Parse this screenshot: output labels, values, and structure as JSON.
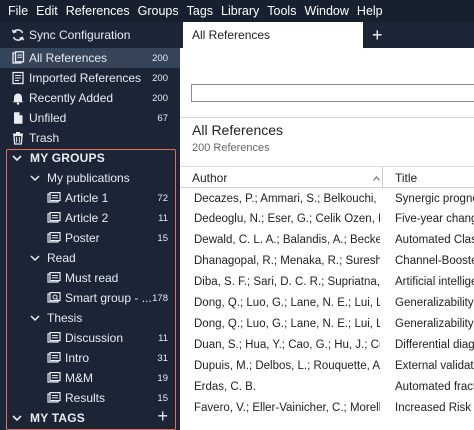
{
  "menubar": {
    "items": [
      "File",
      "Edit",
      "References",
      "Groups",
      "Tags",
      "Library",
      "Tools",
      "Window",
      "Help"
    ]
  },
  "sidebar": {
    "sync": {
      "label": "Sync Configuration",
      "icon": "sync-icon"
    },
    "library": [
      {
        "label": "All References",
        "count": "200",
        "icon": "references-icon",
        "selected": true
      },
      {
        "label": "Imported References",
        "count": "200",
        "icon": "imported-icon"
      },
      {
        "label": "Recently Added",
        "count": "200",
        "icon": "bell-icon"
      },
      {
        "label": "Unfiled",
        "count": "67",
        "icon": "document-icon"
      },
      {
        "label": "Trash",
        "count": "",
        "icon": "trash-icon"
      }
    ],
    "my_groups": {
      "label": "MY GROUPS",
      "folders": [
        {
          "label": "My publications",
          "children": [
            {
              "label": "Article 1",
              "count": "72"
            },
            {
              "label": "Article 2",
              "count": "11"
            },
            {
              "label": "Poster",
              "count": "15"
            }
          ]
        },
        {
          "label": "Read",
          "children": [
            {
              "label": "Must read",
              "count": ""
            },
            {
              "label": "Smart group - ...",
              "count": "178"
            }
          ]
        },
        {
          "label": "Thesis",
          "children": [
            {
              "label": "Discussion",
              "count": "11"
            },
            {
              "label": "Intro",
              "count": "31"
            },
            {
              "label": "M&M",
              "count": "19"
            },
            {
              "label": "Results",
              "count": "15"
            }
          ]
        }
      ]
    },
    "my_tags": {
      "label": "MY TAGS",
      "add": "+"
    }
  },
  "main": {
    "tab": {
      "label": "All References",
      "add": "+"
    },
    "search": {
      "placeholder": ""
    },
    "heading": "All References",
    "subheading": "200 References",
    "columns": {
      "author": "Author",
      "title": "Title"
    },
    "rows": [
      {
        "author": "Decazes, P.; Ammari, S.; Belkouchi, Y.;...",
        "title": "Synergic prognostic"
      },
      {
        "author": "Dedeoglu, N.; Eser, G.; Celik Ozen, D.; ...",
        "title": "Five-year change"
      },
      {
        "author": "Dewald, C. L. A.; Balandis, A.; Becker, ...",
        "title": "Automated Classific"
      },
      {
        "author": "Dhanagopal, R.; Menaka, R.; Suresh K...",
        "title": "Channel-Boosted"
      },
      {
        "author": "Diba, S. F.; Sari, D. C. R.; Supriatna, Y.;...",
        "title": "Artificial intelligence"
      },
      {
        "author": "Dong, Q.; Luo, G.; Lane, N. E.; Lui, L. Y.;...",
        "title": "Generalizability of"
      },
      {
        "author": "Dong, Q.; Luo, G.; Lane, N. E.; Lui, L. Y.;...",
        "title": "Generalizability of"
      },
      {
        "author": "Duan, S.; Hua, Y.; Cao, G.; Hu, J.; Cui, ...",
        "title": "Differential diagnosis"
      },
      {
        "author": "Dupuis, M.; Delbos, L.; Rouquette, A.; ...",
        "title": "External validation"
      },
      {
        "author": "Erdas, C. B.",
        "title": "Automated fracture"
      },
      {
        "author": "Favero, V.; Eller-Vainicher, C.; Morelli, ...",
        "title": "Increased Risk of"
      }
    ]
  },
  "colors": {
    "menubar_bg": "#17202e",
    "sidebar_bg": "#1c2536",
    "sidebar_selected": "#36445a",
    "groups_highlight": "#e0705c"
  }
}
